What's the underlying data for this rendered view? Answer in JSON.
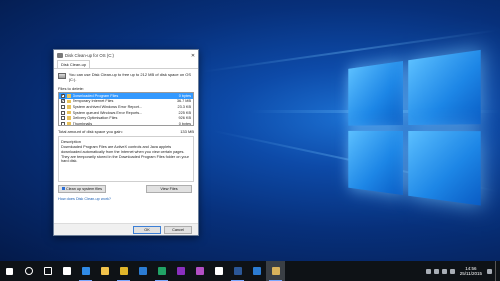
{
  "dialog": {
    "title": "Disk Clean-up for OS (C:)",
    "tab": "Disk Clean-up",
    "intro": "You can use Disk Clean-up to free up to 212 MB of disk space on OS (C:).",
    "files_label": "Files to delete:",
    "files": [
      {
        "name": "Downloaded Program Files",
        "size": "0 bytes",
        "checked": true,
        "selected": true
      },
      {
        "name": "Temporary Internet Files",
        "size": "36.7 MB",
        "checked": true,
        "selected": false
      },
      {
        "name": "System archived Windows Error Report...",
        "size": "23.3 KB",
        "checked": false,
        "selected": false
      },
      {
        "name": "System queued Windows Error Reports...",
        "size": "225 KB",
        "checked": false,
        "selected": false
      },
      {
        "name": "Delivery Optimisation Files",
        "size": "926 KB",
        "checked": false,
        "selected": false
      },
      {
        "name": "Thumbnails",
        "size": "0 bytes",
        "checked": false,
        "selected": false
      }
    ],
    "total_label": "Total amount of disk space you gain:",
    "total_value": "133 MB",
    "description_label": "Description",
    "description": "Downloaded Program Files are ActiveX controls and Java applets downloaded automatically from the Internet when you view certain pages. They are temporarily stored in the Downloaded Program Files folder on your hard disk.",
    "cleanup_system_label": "Clean up system files",
    "view_files_label": "View Files",
    "help_link": "How does Disk Clean-up work?",
    "ok_label": "OK",
    "cancel_label": "Cancel"
  },
  "taskbar": {
    "apps": [
      {
        "name": "start-button",
        "color": "#ffffff"
      },
      {
        "name": "search-button",
        "color": "#ffffff"
      },
      {
        "name": "task-view-button",
        "color": "#ffffff"
      },
      {
        "name": "store-app",
        "color": "#ffffff"
      },
      {
        "name": "edge-app",
        "color": "#2f8ae6"
      },
      {
        "name": "file-explorer-app",
        "color": "#f0c24b"
      },
      {
        "name": "chrome-app",
        "color": "#e0b52a"
      },
      {
        "name": "mail-app",
        "color": "#2b7cd3"
      },
      {
        "name": "excel-app",
        "color": "#21a366"
      },
      {
        "name": "onenote-app",
        "color": "#8a2fbe"
      },
      {
        "name": "video-app",
        "color": "#b34fc4"
      },
      {
        "name": "xbox-app",
        "color": "#ffffff"
      },
      {
        "name": "word-app",
        "color": "#2b5797"
      },
      {
        "name": "photos-app",
        "color": "#2b7cd3"
      },
      {
        "name": "disk-cleanup-app",
        "color": "#d9b25b"
      }
    ],
    "time": "14:56",
    "date": "25/11/2015"
  }
}
